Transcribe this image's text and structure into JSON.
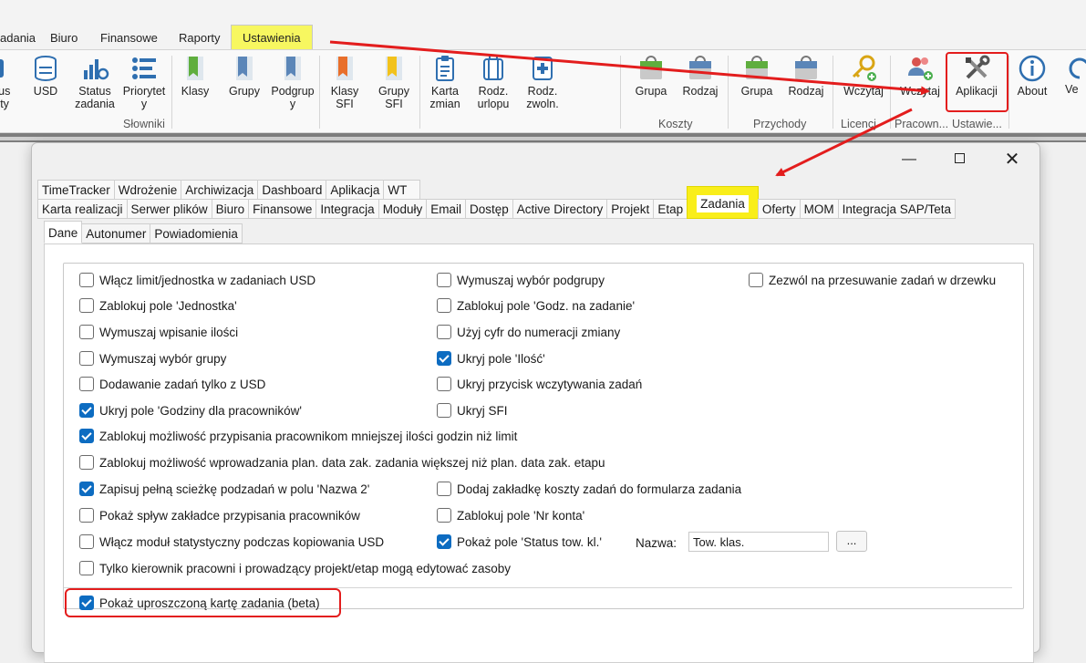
{
  "menubar": {
    "tabs": [
      "adania",
      "Biuro",
      "Finansowe",
      "Raporty",
      "Ustawienia"
    ]
  },
  "ribbon": {
    "buttons": [
      {
        "label": "tus\nrty",
        "icon": "status-icon"
      },
      {
        "label": "USD",
        "icon": "database-icon"
      },
      {
        "label": "Status\nzadania",
        "icon": "chart-gear-icon"
      },
      {
        "label": "Priorytet\ny",
        "icon": "priority-list-icon"
      },
      {
        "label": "Klasy",
        "icon": "green-bookmark-icon"
      },
      {
        "label": "Grupy",
        "icon": "blue-bookmark-icon"
      },
      {
        "label": "Podgrup\ny",
        "icon": "blue-bookmark-icon"
      },
      {
        "label": "Klasy\nSFI",
        "icon": "orange-bookmark-icon"
      },
      {
        "label": "Grupy\nSFI",
        "icon": "yellow-bookmark-icon"
      },
      {
        "label": "Karta\nzmian",
        "icon": "clipboard-icon"
      },
      {
        "label": "Rodz.\nurlopu",
        "icon": "suitcase-icon"
      },
      {
        "label": "Rodz.\nzwoln.",
        "icon": "medical-icon"
      },
      {
        "label": "Grupa",
        "icon": "green-bag-icon"
      },
      {
        "label": "Rodzaj",
        "icon": "grey-bag-icon"
      },
      {
        "label": "Grupa",
        "icon": "green-bag-icon"
      },
      {
        "label": "Rodzaj",
        "icon": "grey-bag-icon"
      },
      {
        "label": "Wczytaj",
        "icon": "key-icon"
      },
      {
        "label": "Wczytaj",
        "icon": "users-add-icon"
      },
      {
        "label": "Aplikacji",
        "icon": "tools-icon"
      },
      {
        "label": "About",
        "icon": "info-icon"
      },
      {
        "label": "Ve",
        "icon": "refresh-icon"
      }
    ],
    "groups": [
      "Słowniki",
      "Koszty",
      "Przychody",
      "Licencj",
      "Pracown...",
      "Ustawie..."
    ]
  },
  "dialog": {
    "tabs_row1": [
      "TimeTracker",
      "Wdrożenie",
      "Archiwizacja",
      "Dashboard",
      "Aplikacja",
      "WT"
    ],
    "tabs_row2": [
      "Karta realizacji",
      "Serwer plików",
      "Biuro",
      "Finansowe",
      "Integracja",
      "Moduły",
      "Email",
      "Dostęp",
      "Active Directory",
      "Projekt",
      "Etap",
      "Zadania",
      "Oferty",
      "MOM",
      "Integracja SAP/Teta"
    ],
    "subtabs": [
      "Dane",
      "Autonumer",
      "Powiadomienia"
    ],
    "options": [
      "Włącz limit/jednostka w zadaniach USD",
      "Wymuszaj wybór podgrupy",
      "Zezwól na przesuwanie zadań w drzewku",
      "Zablokuj pole 'Jednostka'",
      "Zablokuj pole 'Godz. na zadanie'",
      "Wymuszaj wpisanie ilości",
      "Użyj cyfr do numeracji zmiany",
      "Wymuszaj wybór grupy",
      "Ukryj pole 'Ilość'",
      "Dodawanie zadań tylko z USD",
      "Ukryj przycisk wczytywania zadań",
      "Ukryj pole 'Godziny dla pracowników'",
      "Ukryj SFI",
      "Zablokuj możliwość przypisania pracownikom mniejszej ilości godzin niż limit",
      "Zablokuj możliwość wprowadzania plan. data zak. zadania większej niż plan. data zak. etapu",
      "Zapisuj pełną scieżkę podzadań w polu 'Nazwa 2'",
      "Dodaj zakładkę koszty zadań do formularza zadania",
      "Pokaż spływ zakładce przypisania pracowników",
      "Zablokuj pole 'Nr konta'",
      "Włącz moduł statystyczny podczas kopiowania USD",
      "Pokaż pole 'Status tow. kl.'",
      "Tylko kierownik pracowni i prowadzący projekt/etap mogą edytować zasoby",
      "Pokaż uproszczoną kartę zadania (beta)"
    ],
    "name_label": "Nazwa:",
    "name_value": "Tow. klas.",
    "dots_label": "..."
  },
  "colors": {
    "highlight_yellow": "#f9ee1a",
    "annotation_red": "#e31d1d",
    "checkbox_blue": "#0d6cc1"
  }
}
